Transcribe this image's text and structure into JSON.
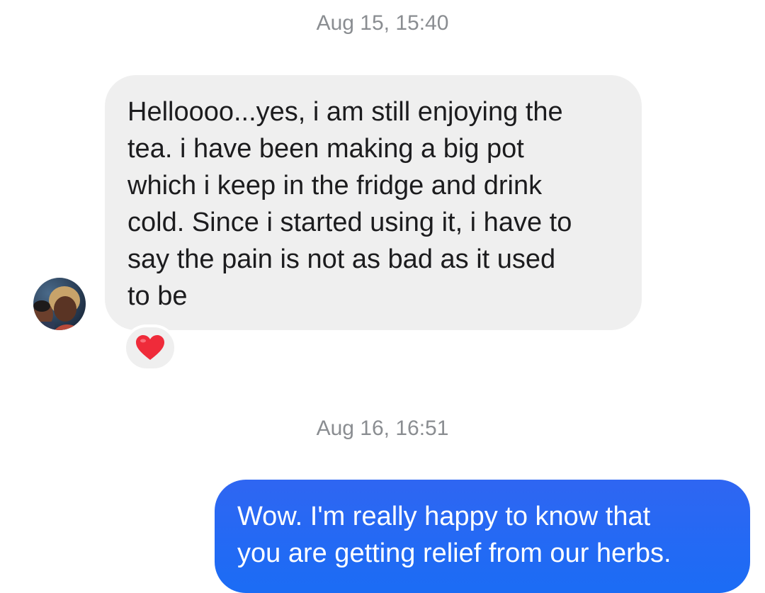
{
  "conversation": {
    "timestamps": [
      "Aug 15, 15:40",
      "Aug 16, 16:51"
    ],
    "incoming": {
      "lines": [
        "Helloooo...yes, i am still enjoying the",
        "tea. i have been making a big pot",
        "which i keep in the fridge and drink",
        "cold. Since i started using it, i have to",
        "say the pain is not as bad as it used",
        "to be"
      ],
      "reaction": "❤️",
      "avatar_icon": "contact-avatar"
    },
    "outgoing": {
      "lines": [
        "Wow. I'm really happy to know that",
        "you are getting relief from our herbs."
      ]
    }
  },
  "colors": {
    "incoming_bubble": "#efefef",
    "outgoing_bubble": "#2f66f2",
    "timestamp": "#8a8d91",
    "reaction_heart": "#ef2b3a"
  }
}
